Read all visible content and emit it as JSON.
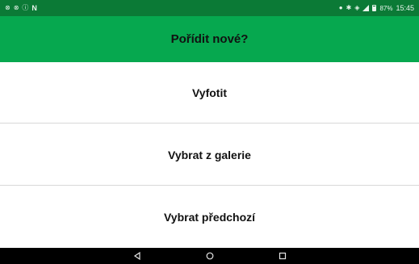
{
  "status_bar": {
    "left_icons": [
      "notification-icon",
      "notification-icon",
      "info-icon",
      "n-icon"
    ],
    "battery_percent": "87%",
    "time": "15:45",
    "battery_level": 0.87
  },
  "app_bar": {
    "title": "Pořídit nové?",
    "color": "#06a84f"
  },
  "options": [
    {
      "label": "Vyfotit"
    },
    {
      "label": "Vybrat z galerie"
    },
    {
      "label": "Vybrat předchozí"
    }
  ],
  "nav_bar": {
    "buttons": [
      "back-icon",
      "home-icon",
      "recents-icon"
    ]
  }
}
